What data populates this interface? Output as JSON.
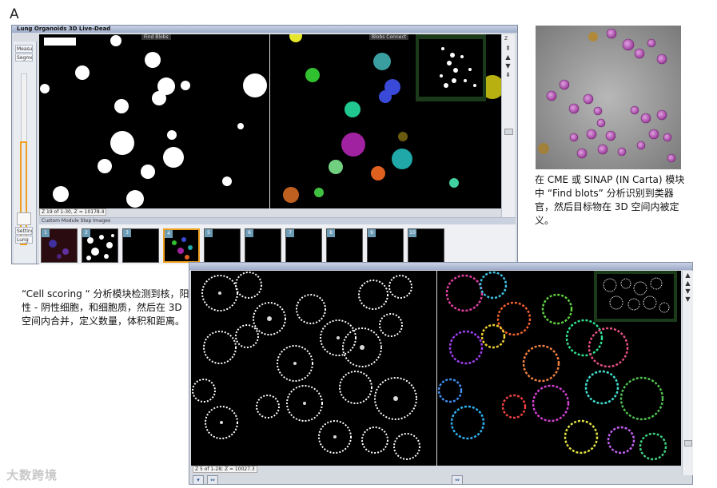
{
  "figure": {
    "panel_letter": "A"
  },
  "top_window": {
    "title": "Lung Organoids 3D Live-Dead",
    "sidebar_tabs": [
      "Measu",
      "Segmen"
    ],
    "sidebar_bottom_tab": "Setting",
    "sidebar_bottom_tab2": "Lung",
    "left_view_label": "Find Blobs",
    "right_view_label": "Blobs Connect",
    "status": "Z 19 of 1-30, Z = 10178.4",
    "strip_header": "Custom Module Step Images",
    "thumbnails": [
      "1",
      "2",
      "3",
      "4",
      "5",
      "6",
      "7",
      "8",
      "9",
      "10"
    ],
    "scroll_label": "Z",
    "scroll_buttons": [
      "⇞",
      "▲",
      "▼",
      "⇟"
    ]
  },
  "bottom_window": {
    "status": "Z 5 of 1-28; Z = 10027.3",
    "scroll_buttons": [
      "▲",
      "▲",
      "▼",
      "▼"
    ]
  },
  "captions": {
    "right": "在 CME 或 SINAP (IN Carta) 模块中 “Find blots” 分析识别到类器官，然后目标物在 3D 空间内被定义。",
    "left": "“Cell scoring “ 分析模块检测到核，阳性 - 阴性细胞，和细胞质，然后在 3D 空间内合并，定义数量，体积和距离。"
  },
  "watermark": "大数跨境",
  "colors": {
    "accent": "#f0a020",
    "window_border": "#7f8aa0",
    "viewer_bg": "#000000"
  }
}
